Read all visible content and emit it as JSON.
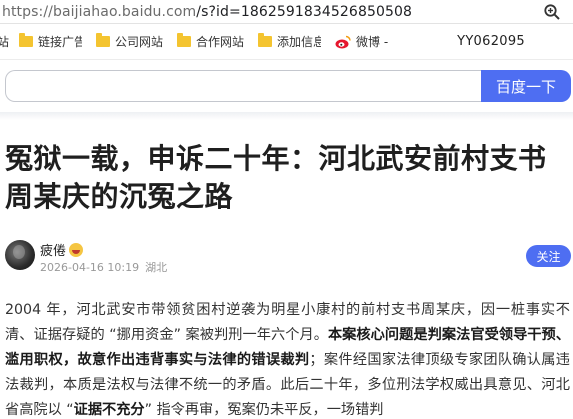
{
  "browser": {
    "url_host": "https://baijiahao.baidu.com",
    "url_rest": "/s?id=1862591834526850508"
  },
  "bookmarks": [
    {
      "label": "站"
    },
    {
      "label": "链接广告"
    },
    {
      "label": "公司网站"
    },
    {
      "label": "合作网站"
    },
    {
      "label": "添加信息"
    },
    {
      "label": "微博 -"
    }
  ],
  "watermark_code": "YY062095",
  "search": {
    "value": "",
    "button_label": "百度一下"
  },
  "article": {
    "title": "冤狱一载，申诉二十年：河北武安前村支书周某庆的沉冤之路",
    "author": "疲倦",
    "date": "2026-04-16 10:19",
    "location": "湖北",
    "follow_label": "关注",
    "para_1a": "2004 年，河北武安市带领贫困村逆袭为明星小康村的前村支书周某庆，因一桩事实不清、证据存疑的 “挪用资金” 案被判刑一年六个月。",
    "para_1b": "本案核心问题是判案法官受领导干预、滥用职权，故意作出违背事实与法律的错误裁判",
    "para_1c": "；案件经国家法律顶级专家团队确认属违法裁判，本质是法权与法律不统一的矛盾。此后二十年，多位刑法学权威出具意见、河北省高院以 “",
    "para_1d": "证据不充分",
    "para_1e": "” 指令再审，冤案仍未平反，一场错判"
  }
}
